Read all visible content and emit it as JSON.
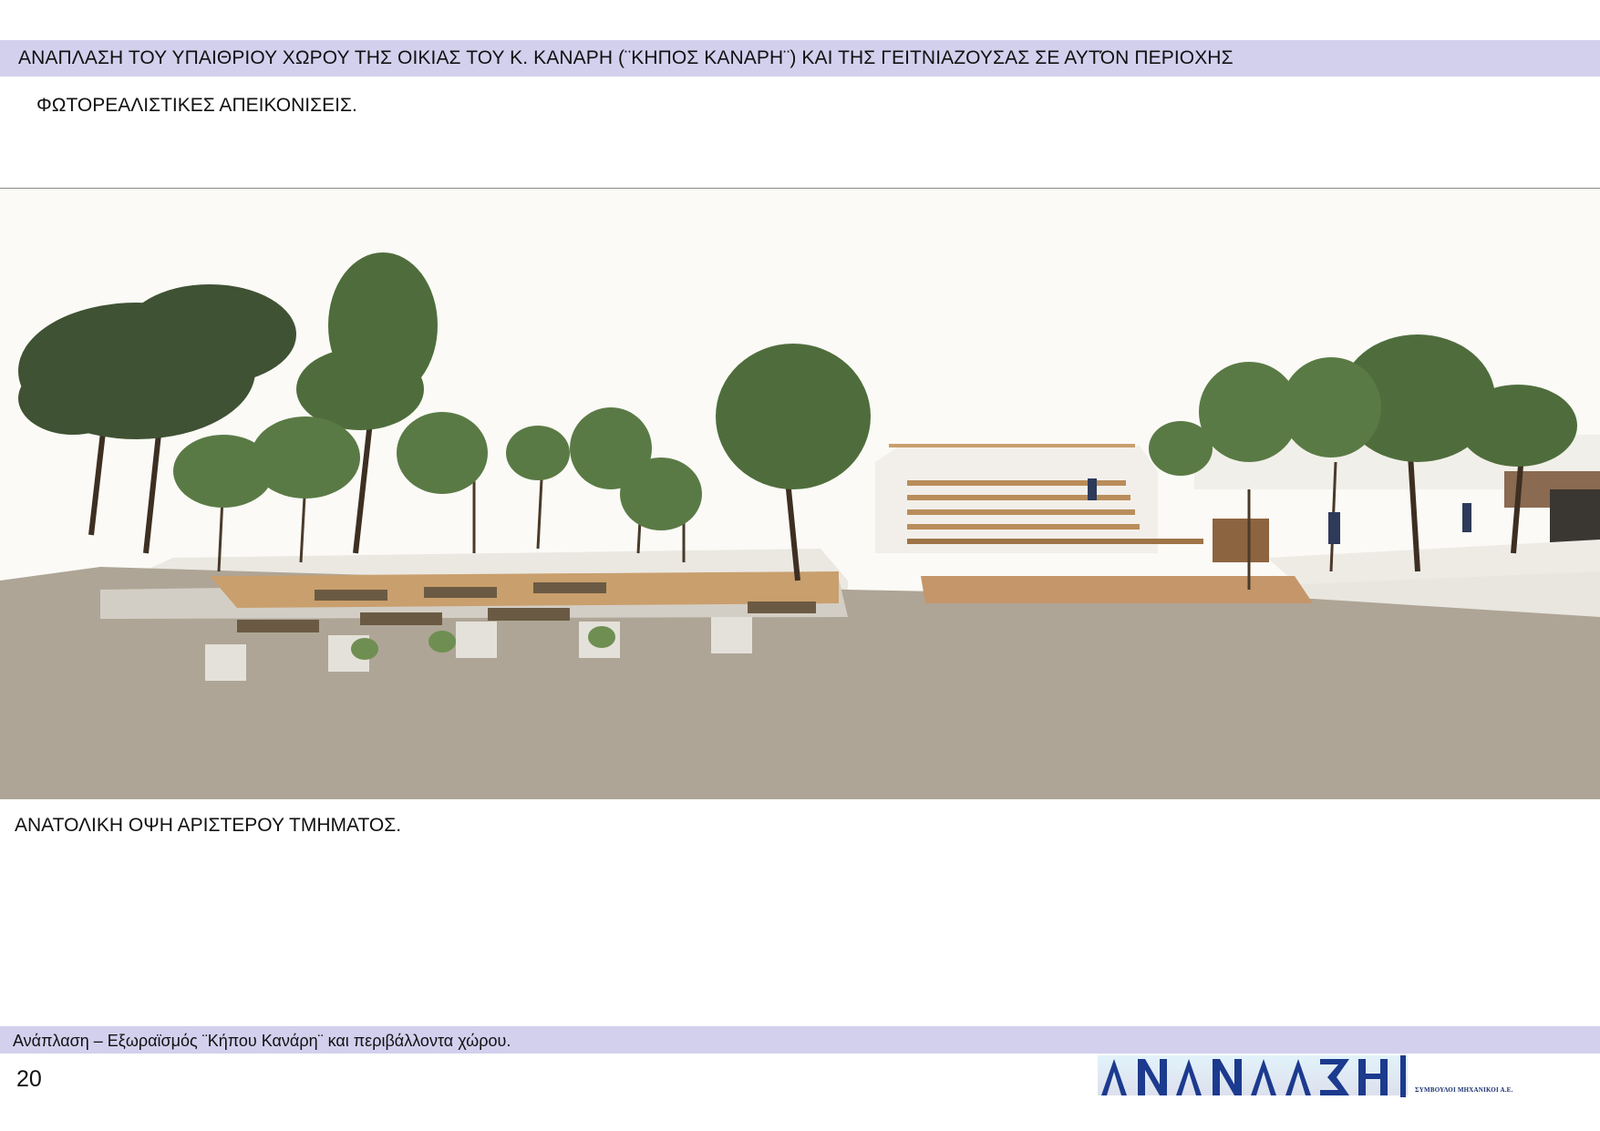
{
  "header": {
    "title": "ΑΝΑΠΛΑΣΗ ΤΟΥ ΥΠΑΙΘΡΙΟΥ ΧΩΡΟΥ ΤΗΣ ΟΙΚΙΑΣ ΤΟΥ Κ. ΚΑΝΑΡΗ (¨ΚΗΠΟΣ ΚΑΝΑΡΗ¨) ΚΑΙ ΤΗΣ ΓΕΙΤΝΙΑΖΟΥΣΑΣ ΣΕ ΑΥΤΌΝ ΠΕΡΙΟΧΗΣ",
    "band_color": "#d3d0ee"
  },
  "section": {
    "subtitle": "ΦΩΤΟΡΕΑΛΙΣΤΙΚΕΣ ΑΠΕΙΚΟΝΙΣΕΙΣ."
  },
  "figure": {
    "caption": "ΑΝΑΤΟΛΙΚΗ ΟΨΗ ΑΡΙΣΤΕΡΟΥ ΤΜΗΜΑΤΟΣ.",
    "palette": {
      "sky": "#fbfaf6",
      "ground": "#aea596",
      "foliage": "#4a6b3a",
      "wood": "#b98d5a",
      "concrete": "#ebe8e2"
    }
  },
  "footer": {
    "text": "Ανάπλαση – Εξωραϊσμός  ¨Κήπου Κανάρη¨  και περιβάλλοντα χώρου.",
    "page_number": "20",
    "logo_text": "ΑΝΑΠΛΑΣΗ",
    "logo_tagline": "ΣΥΜΒΟΥΛΟΙ ΜΗΧΑΝΙΚΟΙ Α.Ε."
  }
}
